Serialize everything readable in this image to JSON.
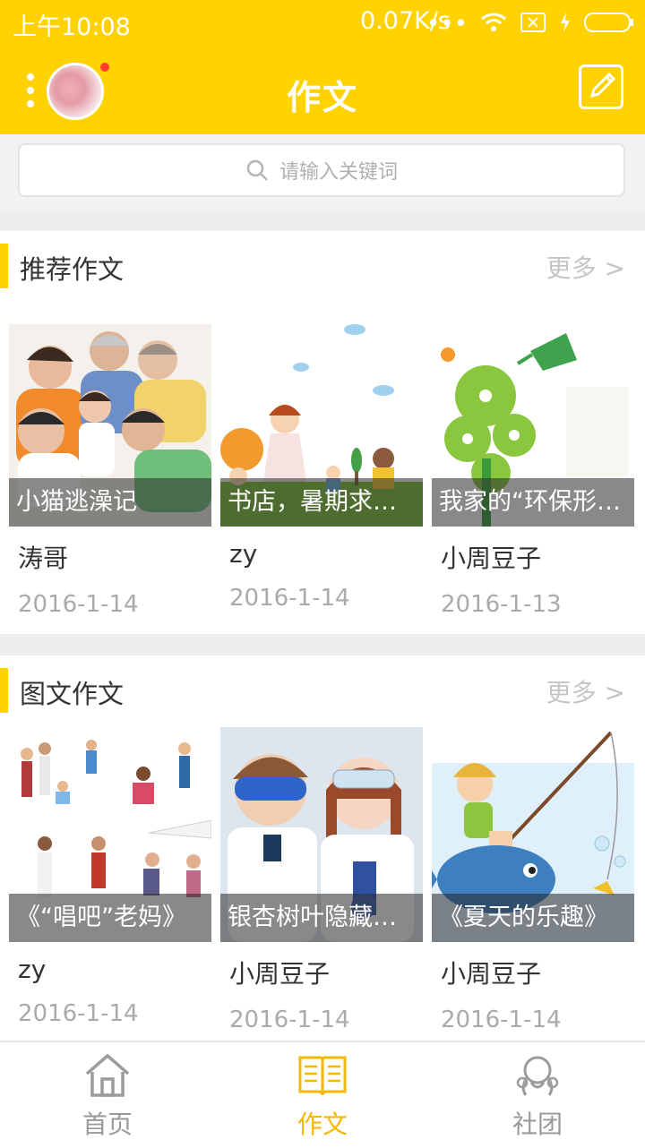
{
  "status_bar": {
    "time": "上午10:08",
    "network_speed": "0.07K/s"
  },
  "app_bar": {
    "title": "作文"
  },
  "search": {
    "placeholder": "请输入关键词"
  },
  "sections": [
    {
      "title": "推荐作文",
      "more": "更多 >",
      "items": [
        {
          "caption": "小猫逃澡记",
          "author": "涛哥",
          "date": "2016-1-14"
        },
        {
          "caption": "书店，暑期求…",
          "author": "zy",
          "date": "2016-1-14"
        },
        {
          "caption": "我家的“环保形…",
          "author": "小周豆子",
          "date": "2016-1-13"
        }
      ]
    },
    {
      "title": "图文作文",
      "more": "更多 >",
      "items": [
        {
          "caption": "《“唱吧”老妈》",
          "author": "zy",
          "date": "2016-1-14"
        },
        {
          "caption": "银杏树叶隐藏…",
          "author": "小周豆子",
          "date": "2016-1-14"
        },
        {
          "caption": "《夏天的乐趣》",
          "author": "小周豆子",
          "date": "2016-1-14"
        }
      ]
    }
  ],
  "tabs": [
    {
      "label": "首页",
      "icon": "home-icon"
    },
    {
      "label": "作文",
      "icon": "book-icon",
      "active": true
    },
    {
      "label": "社团",
      "icon": "community-icon"
    }
  ],
  "colors": {
    "accent": "#FFD200",
    "active_tab": "#F5B700"
  }
}
